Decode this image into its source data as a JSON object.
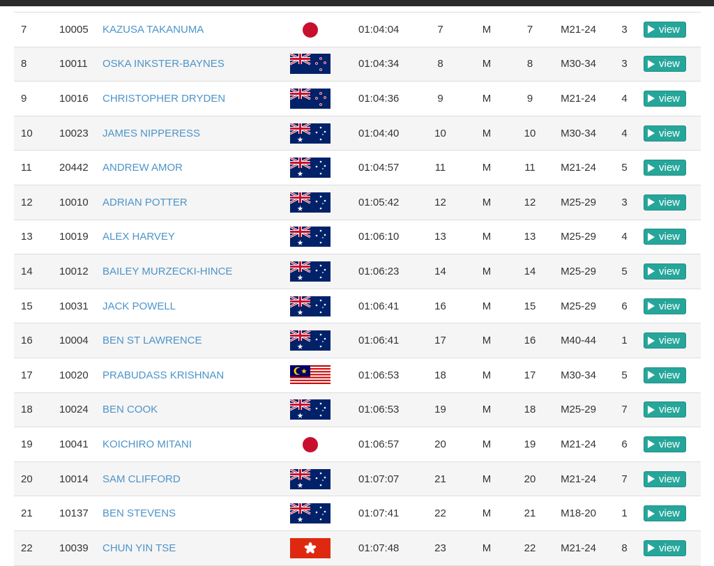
{
  "view_label": "view",
  "rows": [
    {
      "rank": "7",
      "bib": "10005",
      "name": "KAZUSA TAKANUMA",
      "country": "japan",
      "time": "01:04:04",
      "overall": "7",
      "gender": "M",
      "gender_pos": "7",
      "category": "M21-24",
      "cat_pos": "3"
    },
    {
      "rank": "8",
      "bib": "10011",
      "name": "OSKA INKSTER-BAYNES",
      "country": "new-zealand",
      "time": "01:04:34",
      "overall": "8",
      "gender": "M",
      "gender_pos": "8",
      "category": "M30-34",
      "cat_pos": "3"
    },
    {
      "rank": "9",
      "bib": "10016",
      "name": "CHRISTOPHER DRYDEN",
      "country": "new-zealand",
      "time": "01:04:36",
      "overall": "9",
      "gender": "M",
      "gender_pos": "9",
      "category": "M21-24",
      "cat_pos": "4"
    },
    {
      "rank": "10",
      "bib": "10023",
      "name": "JAMES NIPPERESS",
      "country": "australia",
      "time": "01:04:40",
      "overall": "10",
      "gender": "M",
      "gender_pos": "10",
      "category": "M30-34",
      "cat_pos": "4"
    },
    {
      "rank": "11",
      "bib": "20442",
      "name": "ANDREW AMOR",
      "country": "australia",
      "time": "01:04:57",
      "overall": "11",
      "gender": "M",
      "gender_pos": "11",
      "category": "M21-24",
      "cat_pos": "5"
    },
    {
      "rank": "12",
      "bib": "10010",
      "name": "ADRIAN POTTER",
      "country": "australia",
      "time": "01:05:42",
      "overall": "12",
      "gender": "M",
      "gender_pos": "12",
      "category": "M25-29",
      "cat_pos": "3"
    },
    {
      "rank": "13",
      "bib": "10019",
      "name": "ALEX HARVEY",
      "country": "australia",
      "time": "01:06:10",
      "overall": "13",
      "gender": "M",
      "gender_pos": "13",
      "category": "M25-29",
      "cat_pos": "4"
    },
    {
      "rank": "14",
      "bib": "10012",
      "name": "BAILEY MURZECKI-HINCE",
      "country": "australia",
      "time": "01:06:23",
      "overall": "14",
      "gender": "M",
      "gender_pos": "14",
      "category": "M25-29",
      "cat_pos": "5"
    },
    {
      "rank": "15",
      "bib": "10031",
      "name": "JACK POWELL",
      "country": "australia",
      "time": "01:06:41",
      "overall": "16",
      "gender": "M",
      "gender_pos": "15",
      "category": "M25-29",
      "cat_pos": "6"
    },
    {
      "rank": "16",
      "bib": "10004",
      "name": "BEN ST LAWRENCE",
      "country": "australia",
      "time": "01:06:41",
      "overall": "17",
      "gender": "M",
      "gender_pos": "16",
      "category": "M40-44",
      "cat_pos": "1"
    },
    {
      "rank": "17",
      "bib": "10020",
      "name": "PRABUDASS KRISHNAN",
      "country": "malaysia",
      "time": "01:06:53",
      "overall": "18",
      "gender": "M",
      "gender_pos": "17",
      "category": "M30-34",
      "cat_pos": "5"
    },
    {
      "rank": "18",
      "bib": "10024",
      "name": "BEN COOK",
      "country": "australia",
      "time": "01:06:53",
      "overall": "19",
      "gender": "M",
      "gender_pos": "18",
      "category": "M25-29",
      "cat_pos": "7"
    },
    {
      "rank": "19",
      "bib": "10041",
      "name": "KOICHIRO MITANI",
      "country": "japan",
      "time": "01:06:57",
      "overall": "20",
      "gender": "M",
      "gender_pos": "19",
      "category": "M21-24",
      "cat_pos": "6"
    },
    {
      "rank": "20",
      "bib": "10014",
      "name": "SAM CLIFFORD",
      "country": "australia",
      "time": "01:07:07",
      "overall": "21",
      "gender": "M",
      "gender_pos": "20",
      "category": "M21-24",
      "cat_pos": "7"
    },
    {
      "rank": "21",
      "bib": "10137",
      "name": "BEN STEVENS",
      "country": "australia",
      "time": "01:07:41",
      "overall": "22",
      "gender": "M",
      "gender_pos": "21",
      "category": "M18-20",
      "cat_pos": "1"
    },
    {
      "rank": "22",
      "bib": "10039",
      "name": "CHUN YIN TSE",
      "country": "hong-kong",
      "time": "01:07:48",
      "overall": "23",
      "gender": "M",
      "gender_pos": "22",
      "category": "M21-24",
      "cat_pos": "8"
    }
  ],
  "colors": {
    "link": "#4d94c8",
    "button": "#26a69a",
    "row_alt": "#f5f5f5"
  }
}
